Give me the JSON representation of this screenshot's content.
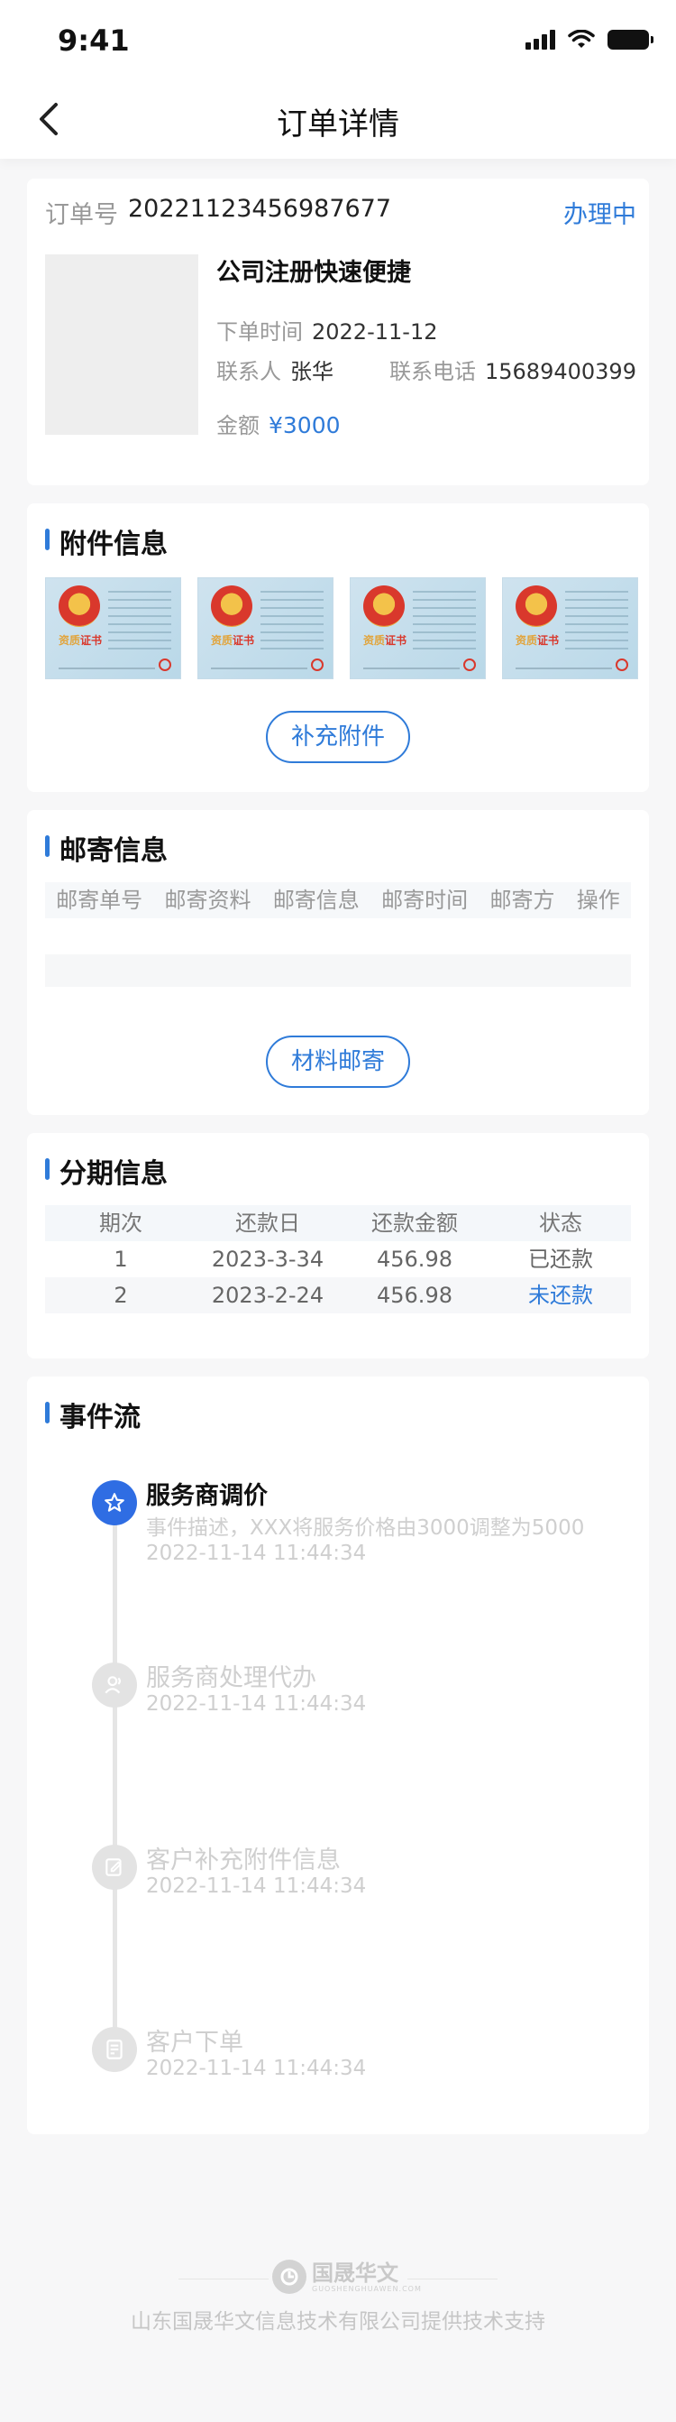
{
  "status_bar": {
    "time": "9:41"
  },
  "nav": {
    "title": "订单详情"
  },
  "order": {
    "no_label": "订单号",
    "no": "20221123456987677",
    "status": "办理中",
    "product_name": "公司注册快速便捷",
    "order_time_label": "下单时间",
    "order_time": "2022-11-12",
    "contact_label": "联系人",
    "contact": "张华",
    "phone_label": "联系电话",
    "phone": "15689400399",
    "amount_label": "金额",
    "amount": "¥3000"
  },
  "attachments": {
    "title": "附件信息",
    "items": [
      {
        "icon": "certificate-thumbnail"
      },
      {
        "icon": "certificate-thumbnail"
      },
      {
        "icon": "certificate-thumbnail"
      },
      {
        "icon": "certificate-thumbnail"
      }
    ],
    "add_button": "补充附件"
  },
  "mailing": {
    "title": "邮寄信息",
    "columns": [
      "邮寄单号",
      "邮寄资料",
      "邮寄信息",
      "邮寄时间",
      "邮寄方",
      "操作"
    ],
    "rows": [],
    "button": "材料邮寄"
  },
  "installments": {
    "title": "分期信息",
    "columns": [
      "期次",
      "还款日",
      "还款金额",
      "状态"
    ],
    "rows": [
      {
        "period": "1",
        "date": "2023-3-34",
        "amount": "456.98",
        "status": "已还款"
      },
      {
        "period": "2",
        "date": "2023-2-24",
        "amount": "456.98",
        "status": "未还款"
      }
    ]
  },
  "events": {
    "title": "事件流",
    "items": [
      {
        "title": "服务商调价",
        "desc": "事件描述，XXX将服务价格由3000调整为5000",
        "time": "2022-11-14 11:44:34",
        "icon": "star-icon",
        "active": true
      },
      {
        "title": "服务商处理代办",
        "time": "2022-11-14 11:44:34",
        "icon": "users-icon",
        "active": false
      },
      {
        "title": "客户补充附件信息",
        "time": "2022-11-14 11:44:34",
        "icon": "edit-doc-icon",
        "active": false
      },
      {
        "title": "客户下单",
        "time": "2022-11-14 11:44:34",
        "icon": "order-doc-icon",
        "active": false
      }
    ]
  },
  "footer": {
    "logo_text": "国晟华文",
    "logo_sub": "GUOSHENGHUAWEN.COM",
    "support": "山东国晟华文信息技术有限公司提供技术支持"
  },
  "colors": {
    "accent": "#2f7bd9",
    "active_node": "#2f6de3",
    "muted": "#cfcfcf"
  }
}
